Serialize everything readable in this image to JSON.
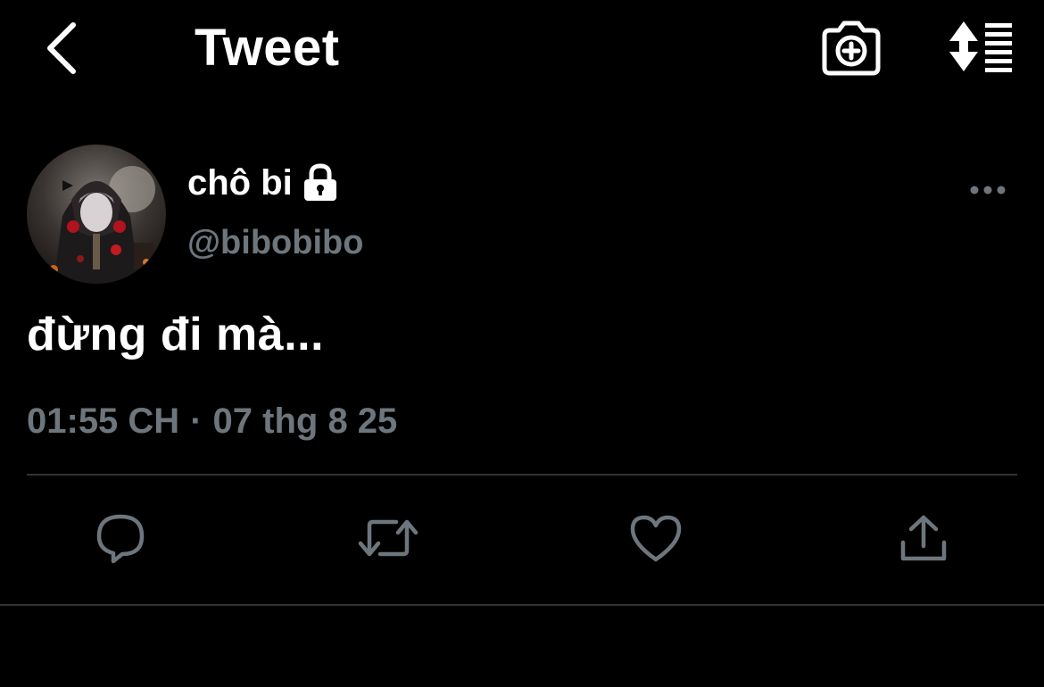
{
  "header": {
    "title": "Tweet",
    "icons": {
      "back": "chevron-left-icon",
      "camera": "camera-add-icon",
      "sort": "sort-list-icon"
    }
  },
  "tweet": {
    "author": {
      "display_name": "chô bi",
      "handle": "@bibobibo",
      "protected": true
    },
    "text": "đừng đi mà...",
    "time": "01:55 CH",
    "separator": "·",
    "date": "07 thg 8 25"
  },
  "actions": [
    "reply",
    "retweet",
    "like",
    "share"
  ],
  "colors": {
    "background": "#000000",
    "primary_text": "#ffffff",
    "secondary_text": "#6e767d",
    "divider": "#2f3336"
  }
}
